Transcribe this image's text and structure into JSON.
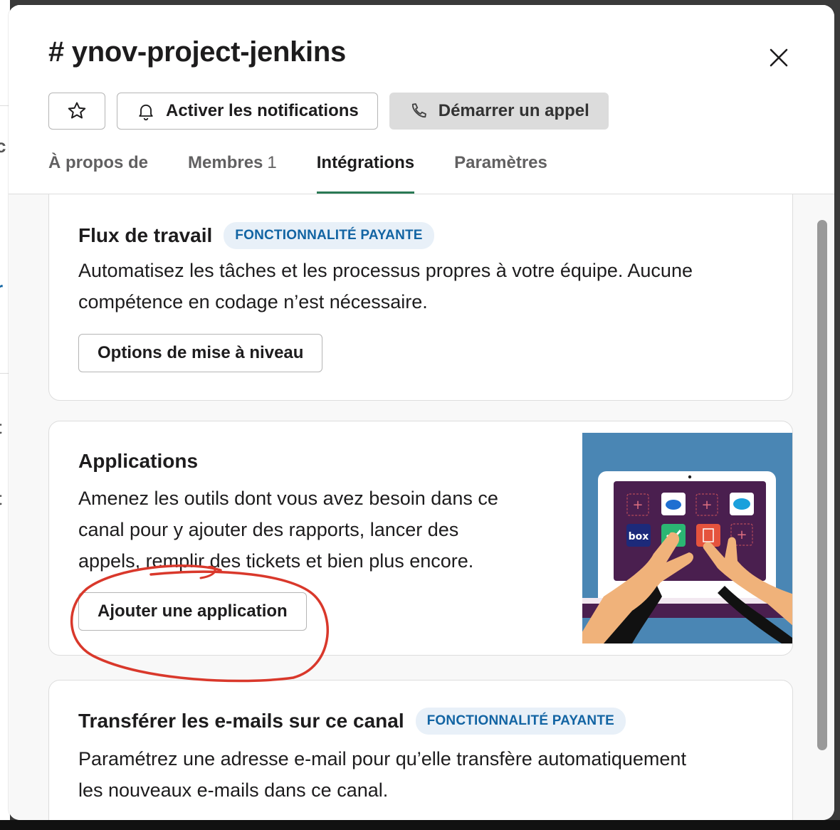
{
  "modal": {
    "title": "# ynov-project-jenkins",
    "actions": {
      "notifications_label": "Activer les notifications",
      "call_label": "Démarrer un appel"
    },
    "tabs": [
      {
        "label": "À propos de"
      },
      {
        "label": "Membres",
        "count": "1"
      },
      {
        "label": "Intégrations",
        "active": true
      },
      {
        "label": "Paramètres"
      }
    ]
  },
  "cards": {
    "workflow": {
      "title": "Flux de travail",
      "badge": "FONCTIONNALITÉ PAYANTE",
      "desc_line1": "Automatisez les tâches et les processus propres à votre équipe. Aucune",
      "desc_line2": "compétence en codage n’est nécessaire.",
      "button": "Options de mise à niveau"
    },
    "apps": {
      "title": "Applications",
      "desc_line1": "Amenez les outils dont vous avez besoin dans ce",
      "desc_line2": "canal pour y ajouter des rapports, lancer des",
      "desc_line3": "appels, remplir des tickets et bien plus encore.",
      "button": "Ajouter une application",
      "illustration_tiles": [
        "box"
      ]
    },
    "email": {
      "title": "Transférer les e-mails sur ce canal",
      "badge": "FONCTIONNALITÉ PAYANTE",
      "desc_line1": "Paramétrez une adresse e-mail pour qu’elle transfère automatiquement",
      "desc_line2": "les nouveaux e-mails dans ce canal."
    }
  },
  "icons": {
    "star": "star-icon",
    "bell": "bell-icon",
    "phone": "phone-icon",
    "close": "close-icon"
  },
  "colors": {
    "accent_tab": "#2a7a55",
    "badge_text": "#1264a3",
    "badge_bg": "#e8f0f8",
    "annotation": "#d9382b",
    "illustration_bg": "#4a86b4",
    "laptop_screen": "#4a1f4f"
  }
}
